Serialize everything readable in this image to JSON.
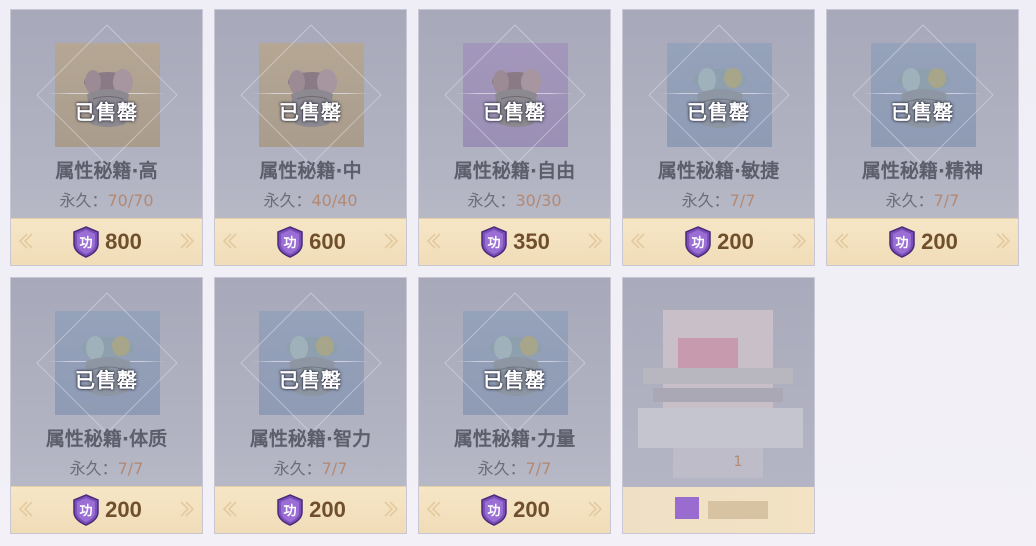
{
  "shop": {
    "currency_icon": "gong-merit-coin-icon",
    "currency_glyph": "功",
    "colors": {
      "card_bg": "#a7a9ba",
      "price_bar_bg": "#f6e6c6",
      "price_text": "#6f4f2c",
      "limit_value": "#b48973",
      "coin_purple": "#7b4fb8"
    },
    "items": [
      {
        "name": "属性秘籍·高",
        "limit_label": "永久：",
        "limit_value": "70/70",
        "status": "已售罄",
        "price": "800",
        "bg": "orange",
        "icon": "scroll-bundle-icon"
      },
      {
        "name": "属性秘籍·中",
        "limit_label": "永久：",
        "limit_value": "40/40",
        "status": "已售罄",
        "price": "600",
        "bg": "orange",
        "icon": "scroll-bundle-icon"
      },
      {
        "name": "属性秘籍·自由",
        "limit_label": "永久：",
        "limit_value": "30/30",
        "status": "已售罄",
        "price": "350",
        "bg": "purple",
        "icon": "scroll-bundle-icon"
      },
      {
        "name": "属性秘籍·敏捷",
        "limit_label": "永久：",
        "limit_value": "7/7",
        "status": "已售罄",
        "price": "200",
        "bg": "blue",
        "icon": "silk-book-icon"
      },
      {
        "name": "属性秘籍·精神",
        "limit_label": "永久：",
        "limit_value": "7/7",
        "status": "已售罄",
        "price": "200",
        "bg": "blue",
        "icon": "silk-book-icon"
      },
      {
        "name": "属性秘籍·体质",
        "limit_label": "永久：",
        "limit_value": "7/7",
        "status": "已售罄",
        "price": "200",
        "bg": "blue",
        "icon": "silk-book-icon"
      },
      {
        "name": "属性秘籍·智力",
        "limit_label": "永久：",
        "limit_value": "7/7",
        "status": "已售罄",
        "price": "200",
        "bg": "blue",
        "icon": "silk-book-icon"
      },
      {
        "name": "属性秘籍·力量",
        "limit_label": "永久：",
        "limit_value": "7/7",
        "status": "已售罄",
        "price": "200",
        "bg": "blue",
        "icon": "silk-book-icon"
      }
    ],
    "obscured_item": {
      "limit_value": "1"
    }
  }
}
